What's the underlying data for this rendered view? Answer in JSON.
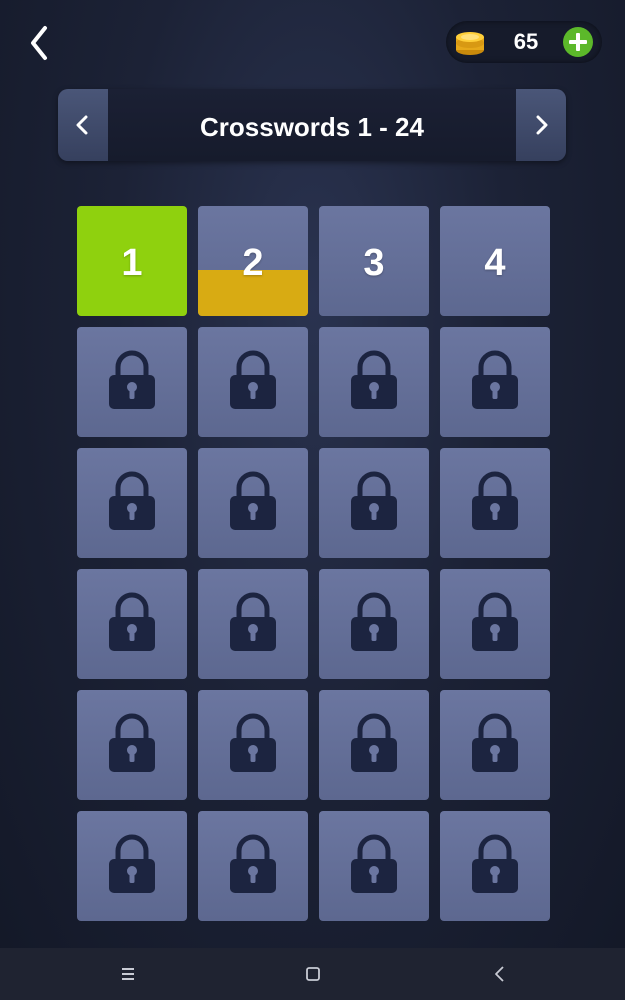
{
  "top_bar": {
    "back_icon": "chevron-left-icon",
    "coins": "65",
    "coin_icon": "gold-coins-icon",
    "add_icon": "plus-circle-icon"
  },
  "header": {
    "title": "Crosswords 1 - 24",
    "prev_icon": "chevron-left-icon",
    "next_icon": "chevron-right-icon"
  },
  "levels": [
    {
      "number": "1",
      "state": "completed"
    },
    {
      "number": "2",
      "state": "in-progress",
      "progress": 0.42
    },
    {
      "number": "3",
      "state": "unlocked"
    },
    {
      "number": "4",
      "state": "unlocked"
    },
    {
      "number": "",
      "state": "locked"
    },
    {
      "number": "",
      "state": "locked"
    },
    {
      "number": "",
      "state": "locked"
    },
    {
      "number": "",
      "state": "locked"
    },
    {
      "number": "",
      "state": "locked"
    },
    {
      "number": "",
      "state": "locked"
    },
    {
      "number": "",
      "state": "locked"
    },
    {
      "number": "",
      "state": "locked"
    },
    {
      "number": "",
      "state": "locked"
    },
    {
      "number": "",
      "state": "locked"
    },
    {
      "number": "",
      "state": "locked"
    },
    {
      "number": "",
      "state": "locked"
    },
    {
      "number": "",
      "state": "locked"
    },
    {
      "number": "",
      "state": "locked"
    },
    {
      "number": "",
      "state": "locked"
    },
    {
      "number": "",
      "state": "locked"
    },
    {
      "number": "",
      "state": "locked"
    },
    {
      "number": "",
      "state": "locked"
    },
    {
      "number": "",
      "state": "locked"
    },
    {
      "number": "",
      "state": "locked"
    }
  ],
  "colors": {
    "completed": "#8fd10e",
    "progress": "#d8ab13",
    "tile": "#6b76a0",
    "lock": "#1c2440",
    "add_button": "#5cb82a"
  },
  "system_nav": {
    "menu_icon": "menu-lines-icon",
    "home_icon": "home-square-icon",
    "back_icon": "back-triangle-icon"
  }
}
